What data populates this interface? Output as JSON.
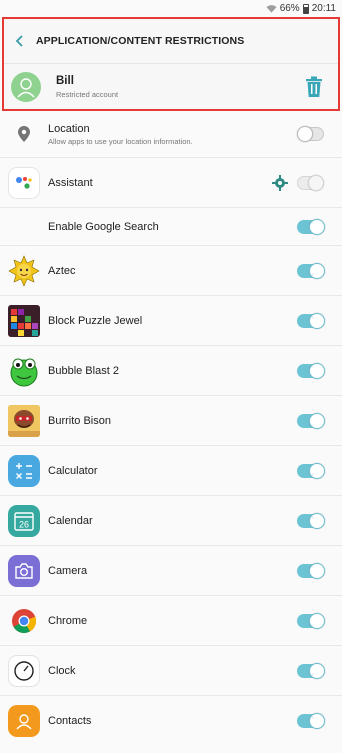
{
  "status": {
    "battery": "66%",
    "time": "20:11"
  },
  "header": {
    "title": "APPLICATION/CONTENT RESTRICTIONS"
  },
  "user": {
    "name": "Bill",
    "subtitle": "Restricted account"
  },
  "rows": [
    {
      "label": "Location",
      "sub": "Allow apps to use your location information.",
      "toggle": "off"
    },
    {
      "label": "Assistant",
      "toggle": "disabled"
    },
    {
      "label": "Enable Google Search",
      "toggle": "on"
    },
    {
      "label": "Aztec",
      "toggle": "on"
    },
    {
      "label": "Block Puzzle Jewel",
      "toggle": "on"
    },
    {
      "label": "Bubble Blast 2",
      "toggle": "on"
    },
    {
      "label": "Burrito Bison",
      "toggle": "on"
    },
    {
      "label": "Calculator",
      "toggle": "on"
    },
    {
      "label": "Calendar",
      "toggle": "on",
      "icon_text": "26"
    },
    {
      "label": "Camera",
      "toggle": "on"
    },
    {
      "label": "Chrome",
      "toggle": "on"
    },
    {
      "label": "Clock",
      "toggle": "on"
    },
    {
      "label": "Contacts",
      "toggle": "on"
    }
  ],
  "colors": {
    "accent": "#6cc3d3",
    "highlight_border": "#e53935",
    "trash": "#3aa7b8"
  }
}
